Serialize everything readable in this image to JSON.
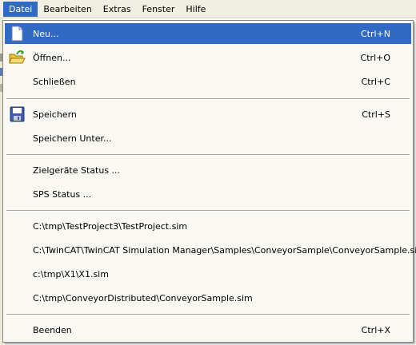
{
  "menubar": {
    "items": [
      {
        "label": "Datei",
        "active": true
      },
      {
        "label": "Bearbeiten"
      },
      {
        "label": "Extras"
      },
      {
        "label": "Fenster"
      },
      {
        "label": "Hilfe"
      }
    ]
  },
  "file_menu": {
    "new": {
      "label": "Neu...",
      "shortcut": "Ctrl+N",
      "icon": "new-document-icon"
    },
    "open": {
      "label": "Öffnen...",
      "shortcut": "Ctrl+O",
      "icon": "open-folder-icon"
    },
    "close": {
      "label": "Schließen",
      "shortcut": "Ctrl+C"
    },
    "save": {
      "label": "Speichern",
      "shortcut": "Ctrl+S",
      "icon": "floppy-disk-icon"
    },
    "save_as": {
      "label": "Speichern Unter..."
    },
    "target_status": {
      "label": "Zielgeräte Status ..."
    },
    "plc_status": {
      "label": "SPS Status ..."
    },
    "recent": [
      "C:\\tmp\\TestProject3\\TestProject.sim",
      "C:\\TwinCAT\\TwinCAT Simulation Manager\\Samples\\ConveyorSample\\ConveyorSample.sim",
      "c:\\tmp\\X1\\X1.sim",
      "C:\\tmp\\ConveyorDistributed\\ConveyorSample.sim"
    ],
    "exit": {
      "label": "Beenden",
      "shortcut": "Ctrl+X"
    }
  },
  "colors": {
    "highlight": "#316ac5",
    "menubar_bg": "#f1efe2",
    "menu_bg": "#f9f8f3"
  }
}
